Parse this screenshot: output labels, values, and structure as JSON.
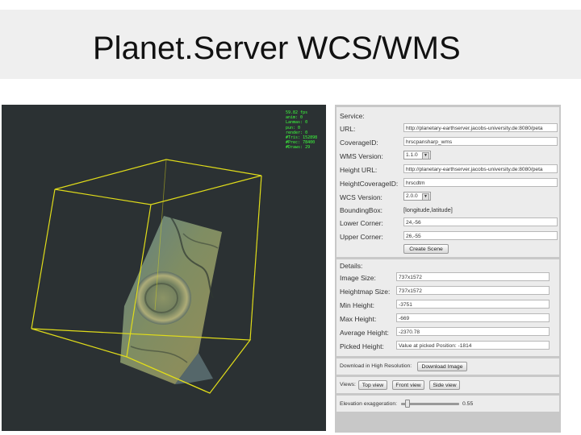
{
  "slide": {
    "title": "Planet.Server WCS/WMS"
  },
  "viewer": {
    "stats": [
      "59.82 fps",
      "anim: 0",
      "Lanmas: 0",
      "pun: 0",
      "render: 0",
      "#Tris: 152898",
      "#Prec: 78400",
      "#Draws: 29"
    ]
  },
  "service": {
    "heading": "Service:",
    "url_label": "URL:",
    "url_value": "http://planetary-earthserver.jacobs-university.de:8080/peta",
    "coverage_label": "CoverageID:",
    "coverage_value": "hrscpansharp_wms",
    "wms_version_label": "WMS Version:",
    "wms_version_value": "1.1.0",
    "height_url_label": "Height URL:",
    "height_url_value": "http://planetary-earthserver.jacobs-university.de:8080/peta",
    "height_coverage_label": "HeightCoverageID:",
    "height_coverage_value": "hrscdtm",
    "wcs_version_label": "WCS Version:",
    "wcs_version_value": "2.0.0",
    "bbox_label": "BoundingBox:",
    "bbox_value": "[longitude,latitude]",
    "lower_label": "Lower Corner:",
    "lower_value": "24,-56",
    "upper_label": "Upper Corner:",
    "upper_value": "26,-55",
    "create_button": "Create Scene"
  },
  "details": {
    "heading": "Details:",
    "image_size_label": "Image Size:",
    "image_size_value": "737x1572",
    "heightmap_size_label": "Heightmap Size:",
    "heightmap_size_value": "737x1572",
    "min_height_label": "Min Height:",
    "min_height_value": "-3751",
    "max_height_label": "Max Height:",
    "max_height_value": "-669",
    "avg_height_label": "Average Height:",
    "avg_height_value": "-2370.78",
    "picked_height_label": "Picked Height:",
    "picked_height_value": "Value at picked Position: -1814"
  },
  "download": {
    "label": "Download in High Resolution:",
    "button": "Download Image"
  },
  "views": {
    "label": "Views:",
    "top": "Top view",
    "front": "Front view",
    "side": "Side view"
  },
  "elevation": {
    "label": "Elevation exaggeration:",
    "value": "0.55",
    "level": 0.55
  }
}
